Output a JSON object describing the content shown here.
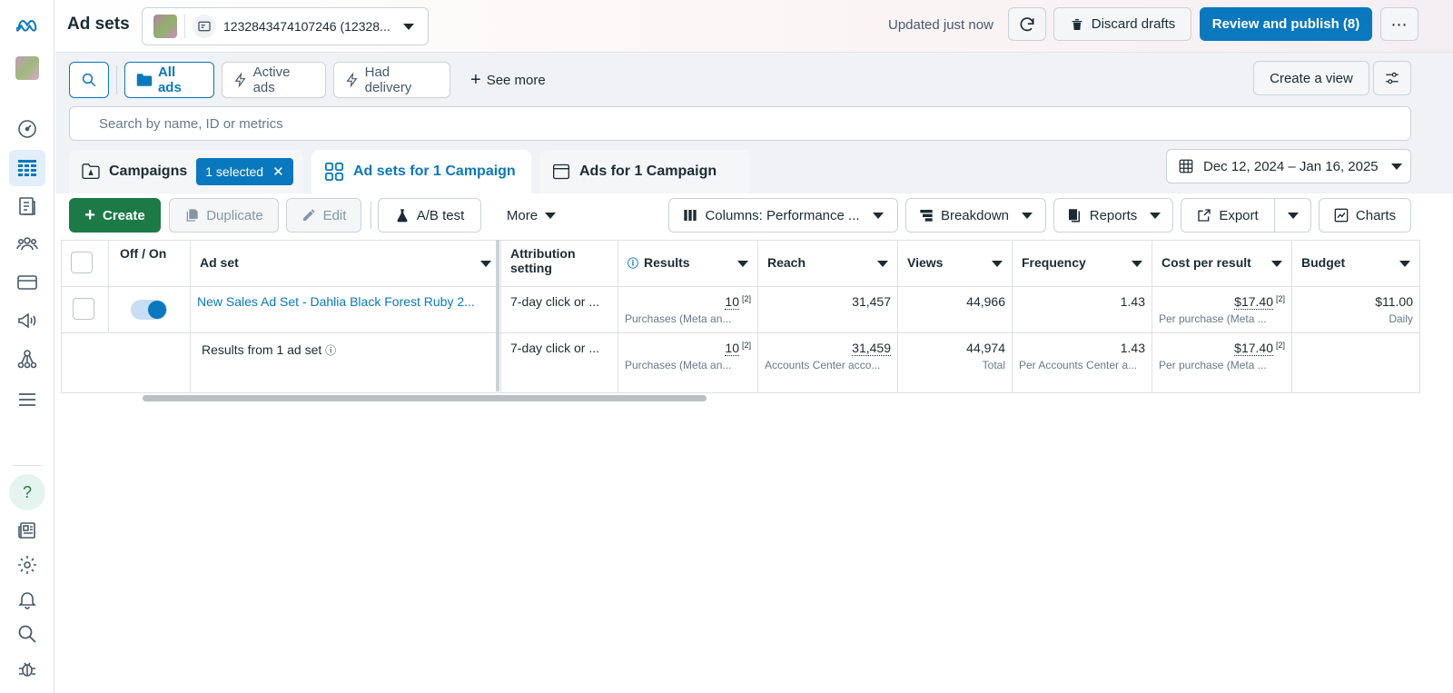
{
  "topbar": {
    "title": "Ad sets",
    "account": "1232843474107246 (12328...",
    "updated": "Updated just now",
    "discard": "Discard drafts",
    "review": "Review and publish (8)"
  },
  "filters": {
    "all_ads": "All ads",
    "active_ads": "Active ads",
    "had_delivery": "Had delivery",
    "see_more": "See more",
    "create_view": "Create a view"
  },
  "search": {
    "placeholder": "Search by name, ID or metrics"
  },
  "tabs": {
    "campaigns": "Campaigns",
    "selected": "1 selected",
    "adsets": "Ad sets for 1 Campaign",
    "ads": "Ads for 1 Campaign"
  },
  "date_range": "Dec 12, 2024 – Jan 16, 2025",
  "actions": {
    "create": "Create",
    "duplicate": "Duplicate",
    "edit": "Edit",
    "ab_test": "A/B test",
    "more": "More",
    "columns": "Columns: Performance ...",
    "breakdown": "Breakdown",
    "reports": "Reports",
    "export": "Export",
    "charts": "Charts"
  },
  "table": {
    "headers": {
      "off_on": "Off / On",
      "ad_set": "Ad set",
      "attribution": "Attribution setting",
      "results": "Results",
      "reach": "Reach",
      "views": "Views",
      "frequency": "Frequency",
      "cost": "Cost per result",
      "budget": "Budget"
    },
    "row": {
      "name": "New Sales Ad Set - Dahlia Black Forest Ruby 2...",
      "attribution": "7-day click or ...",
      "results": "10",
      "results_sup": "[2]",
      "results_sub": "Purchases (Meta an...",
      "reach": "31,457",
      "views": "44,966",
      "frequency": "1.43",
      "cost": "$17.40",
      "cost_sup": "[2]",
      "cost_sub": "Per purchase (Meta ...",
      "budget": "$11.00",
      "budget_sub": "Daily"
    },
    "summary": {
      "label": "Results from 1 ad set",
      "attribution": "7-day click or ...",
      "results": "10",
      "results_sup": "[2]",
      "results_sub": "Purchases (Meta an...",
      "reach": "31,459",
      "reach_sub": "Accounts Center acco...",
      "views": "44,974",
      "views_sub": "Total",
      "frequency": "1.43",
      "frequency_sub": "Per Accounts Center a...",
      "cost": "$17.40",
      "cost_sup": "[2]",
      "cost_sub": "Per purchase (Meta ..."
    }
  },
  "sidebar": {
    "help": "?"
  },
  "colors": {
    "accent": "#0a78be",
    "create": "#1c7a46"
  }
}
